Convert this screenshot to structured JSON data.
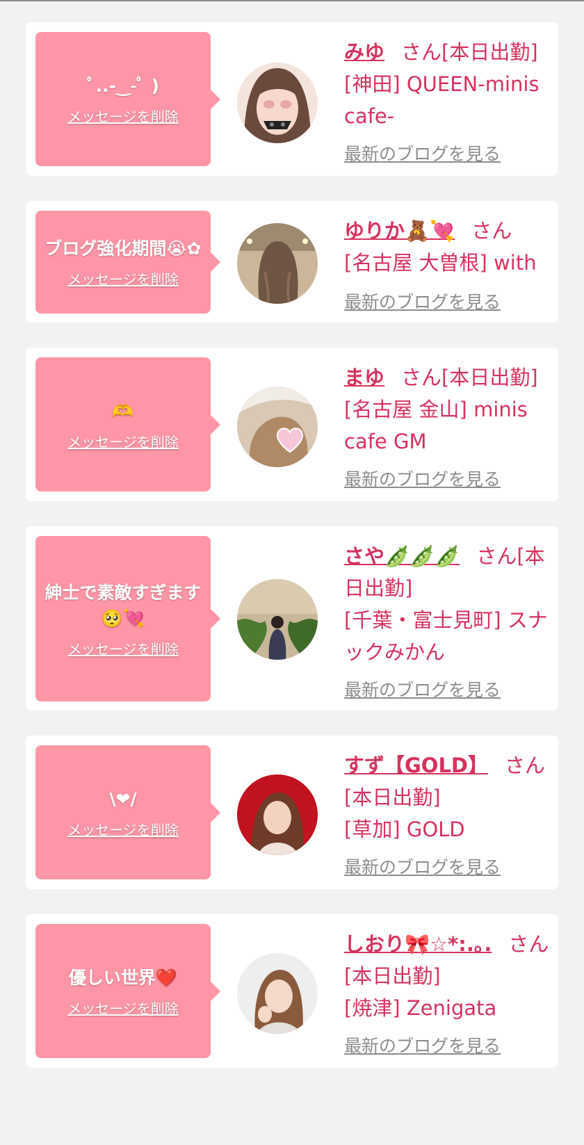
{
  "cards": [
    {
      "message": "ﾟ..-‿-ﾟ )",
      "delete_label": "メッセージを削除",
      "name": "みゆ",
      "san": "さん[本日出勤]",
      "location": "[神田] QUEEN-minis cafe-",
      "blog_link": "最新のブログを見る"
    },
    {
      "message": "ブログ強化期間😭✿",
      "delete_label": "メッセージを削除",
      "name": "ゆりか🧸💘",
      "san": "さん",
      "location": "[名古屋 大曽根] with",
      "blog_link": "最新のブログを見る"
    },
    {
      "message": "🫶",
      "delete_label": "メッセージを削除",
      "name": "まゆ",
      "san": "さん[本日出勤]",
      "location": "[名古屋 金山] minis cafe GM",
      "blog_link": "最新のブログを見る"
    },
    {
      "message": "紳士で素敵すぎます🥺💘",
      "delete_label": "メッセージを削除",
      "name": "さや🫛🫛🫛",
      "san": "さん[本日出勤]",
      "location": "[千葉・富士見町] スナックみかん",
      "blog_link": "最新のブログを見る"
    },
    {
      "message": "\\❤/",
      "delete_label": "メッセージを削除",
      "name": "すず【GOLD】",
      "san": "さん",
      "san2": "[本日出勤]",
      "location": "[草加] GOLD",
      "blog_link": "最新のブログを見る"
    },
    {
      "message": "優しい世界❤️",
      "delete_label": "メッセージを削除",
      "name": "しおり🎀☆*:.｡.",
      "san": "さん",
      "san2": "[本日出勤]",
      "location": "[焼津] Zenigata",
      "blog_link": "最新のブログを見る"
    }
  ],
  "avatars": [
    "girl-with-sunglasses-filter",
    "woman-back-wavy-hair",
    "hair-with-heart-sticker",
    "woman-in-kimono-garden",
    "woman-red-background",
    "woman-white-background"
  ],
  "colors": {
    "accent": "#d6325e",
    "bubble": "#ff96a8",
    "link_gray": "#8c8c8c"
  }
}
